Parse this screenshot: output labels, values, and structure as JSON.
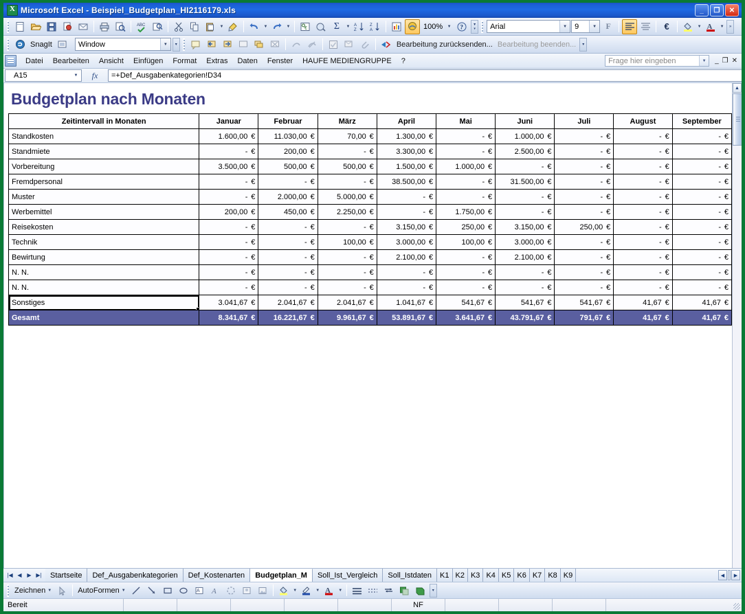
{
  "window": {
    "title": "Microsoft Excel - Beispiel_Budgetplan_HI2116179.xls",
    "app_icon": "excel-icon",
    "minimize": "_",
    "restore": "❐",
    "close": "✕"
  },
  "toolbar_standard": {
    "zoom": "100%",
    "font_name": "Arial",
    "font_size": "9",
    "bold_label": "F",
    "items": [
      "new-icon",
      "open-icon",
      "save-icon",
      "permission-icon",
      "mail-icon",
      "print-icon",
      "print-preview-icon",
      "spelling-icon",
      "research-icon",
      "cut-icon",
      "copy-icon",
      "paste-icon",
      "format-painter-icon",
      "undo-icon",
      "redo-icon",
      "hyperlink-icon",
      "autosum-icon",
      "sort-asc-icon",
      "sort-desc-icon",
      "chart-icon",
      "drawing-icon",
      "help-icon",
      "align-left-icon",
      "align-center-icon",
      "euro-icon",
      "fill-color-icon",
      "font-color-icon"
    ]
  },
  "toolbar_snagit": {
    "label": "SnagIt",
    "capture_icon": "snagit-capture-icon",
    "profile": "Window"
  },
  "toolbar_review": {
    "send_for_review": "Bearbeitung zurücksenden...",
    "end_review": "Bearbeitung beenden..."
  },
  "menubar": {
    "items": [
      "Datei",
      "Bearbeiten",
      "Ansicht",
      "Einfügen",
      "Format",
      "Extras",
      "Daten",
      "Fenster",
      "HAUFE MEDIENGRUPPE",
      "?"
    ],
    "ask_placeholder": "Frage hier eingeben"
  },
  "formulabar": {
    "namebox": "A15",
    "fx_label": "fx",
    "formula": "=+Def_Ausgabenkategorien!D34"
  },
  "sheet": {
    "doc_title": "Budgetplan nach Monaten",
    "row_header_label": "Zeitintervall in Monaten",
    "months": [
      "Januar",
      "Februar",
      "März",
      "April",
      "Mai",
      "Juni",
      "Juli",
      "August",
      "September"
    ],
    "dash": "-",
    "currency": "€",
    "rows": [
      {
        "label": "Standkosten",
        "values": [
          "1.600,00",
          "11.030,00",
          "70,00",
          "1.300,00",
          "-",
          "1.000,00",
          "-",
          "-",
          "-"
        ]
      },
      {
        "label": "Standmiete",
        "values": [
          "-",
          "200,00",
          "-",
          "3.300,00",
          "-",
          "2.500,00",
          "-",
          "-",
          "-"
        ]
      },
      {
        "label": "Vorbereitung",
        "values": [
          "3.500,00",
          "500,00",
          "500,00",
          "1.500,00",
          "1.000,00",
          "-",
          "-",
          "-",
          "-"
        ]
      },
      {
        "label": "Fremdpersonal",
        "values": [
          "-",
          "-",
          "-",
          "38.500,00",
          "-",
          "31.500,00",
          "-",
          "-",
          "-"
        ]
      },
      {
        "label": "Muster",
        "values": [
          "-",
          "2.000,00",
          "5.000,00",
          "-",
          "-",
          "-",
          "-",
          "-",
          "-"
        ]
      },
      {
        "label": "Werbemittel",
        "values": [
          "200,00",
          "450,00",
          "2.250,00",
          "-",
          "1.750,00",
          "-",
          "-",
          "-",
          "-"
        ]
      },
      {
        "label": "Reisekosten",
        "values": [
          "-",
          "-",
          "-",
          "3.150,00",
          "250,00",
          "3.150,00",
          "250,00",
          "-",
          "-"
        ]
      },
      {
        "label": "Technik",
        "values": [
          "-",
          "-",
          "100,00",
          "3.000,00",
          "100,00",
          "3.000,00",
          "-",
          "-",
          "-"
        ]
      },
      {
        "label": "Bewirtung",
        "values": [
          "-",
          "-",
          "-",
          "2.100,00",
          "-",
          "2.100,00",
          "-",
          "-",
          "-"
        ]
      },
      {
        "label": "N. N.",
        "values": [
          "-",
          "-",
          "-",
          "-",
          "-",
          "-",
          "-",
          "-",
          "-"
        ]
      },
      {
        "label": "N. N.",
        "values": [
          "-",
          "-",
          "-",
          "-",
          "-",
          "-",
          "-",
          "-",
          "-"
        ]
      },
      {
        "label": "Sonstiges",
        "selected": true,
        "values": [
          "3.041,67",
          "2.041,67",
          "2.041,67",
          "1.041,67",
          "541,67",
          "541,67",
          "541,67",
          "41,67",
          "41,67"
        ]
      }
    ],
    "total": {
      "label": "Gesamt",
      "values": [
        "8.341,67",
        "16.221,67",
        "9.961,67",
        "53.891,67",
        "3.641,67",
        "43.791,67",
        "791,67",
        "41,67",
        "41,67"
      ]
    },
    "colors": {
      "title": "#3b3b86",
      "total_bg": "#5a5fa0",
      "total_fg": "#ffffff",
      "grid_line": "#000000"
    }
  },
  "sheet_tabs": {
    "nav": [
      "first-sheet",
      "prev-sheet",
      "next-sheet",
      "last-sheet"
    ],
    "items": [
      {
        "label": "Startseite",
        "active": false
      },
      {
        "label": "Def_Ausgabenkategorien",
        "active": false
      },
      {
        "label": "Def_Kostenarten",
        "active": false
      },
      {
        "label": "Budgetplan_M",
        "active": true
      },
      {
        "label": "Soll_Ist_Vergleich",
        "active": false
      },
      {
        "label": "Soll_Istdaten",
        "active": false
      },
      {
        "label": "K1",
        "active": false
      },
      {
        "label": "K2",
        "active": false
      },
      {
        "label": "K3",
        "active": false
      },
      {
        "label": "K4",
        "active": false
      },
      {
        "label": "K5",
        "active": false
      },
      {
        "label": "K6",
        "active": false
      },
      {
        "label": "K7",
        "active": false
      },
      {
        "label": "K8",
        "active": false
      },
      {
        "label": "K9",
        "active": false
      }
    ]
  },
  "drawbar": {
    "draw_label": "Zeichnen",
    "autoshapes_label": "AutoFormen",
    "items": [
      "select-objects-icon",
      "line-icon",
      "arrow-icon",
      "rectangle-icon",
      "oval-icon",
      "textbox-icon",
      "wordart-icon",
      "diagram-icon",
      "clipart-icon",
      "picture-icon",
      "fill-color-icon",
      "line-color-icon",
      "font-color-icon",
      "line-style-icon",
      "dash-style-icon",
      "arrow-style-icon",
      "shadow-icon",
      "3d-icon"
    ]
  },
  "statusbar": {
    "message": "Bereit",
    "mode": "NF"
  }
}
